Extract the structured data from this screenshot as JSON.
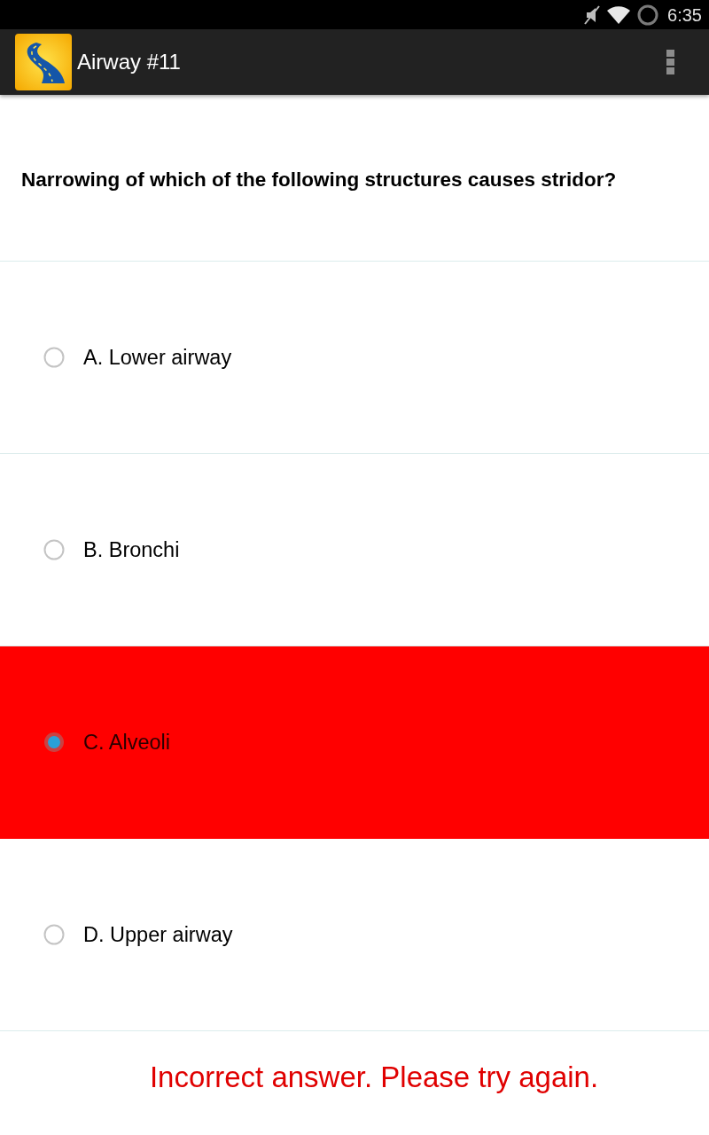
{
  "status_bar": {
    "time": "6:35"
  },
  "action_bar": {
    "title": "Airway #11"
  },
  "question": {
    "text": "Narrowing of which of the following structures causes stridor?"
  },
  "options": [
    {
      "label": "A. Lower airway",
      "selected": false,
      "incorrect": false
    },
    {
      "label": "B. Bronchi",
      "selected": false,
      "incorrect": false
    },
    {
      "label": "C. Alveoli",
      "selected": true,
      "incorrect": true
    },
    {
      "label": "D. Upper airway",
      "selected": false,
      "incorrect": false
    }
  ],
  "feedback": {
    "kind": "error",
    "text": "Incorrect answer. Please try again."
  }
}
